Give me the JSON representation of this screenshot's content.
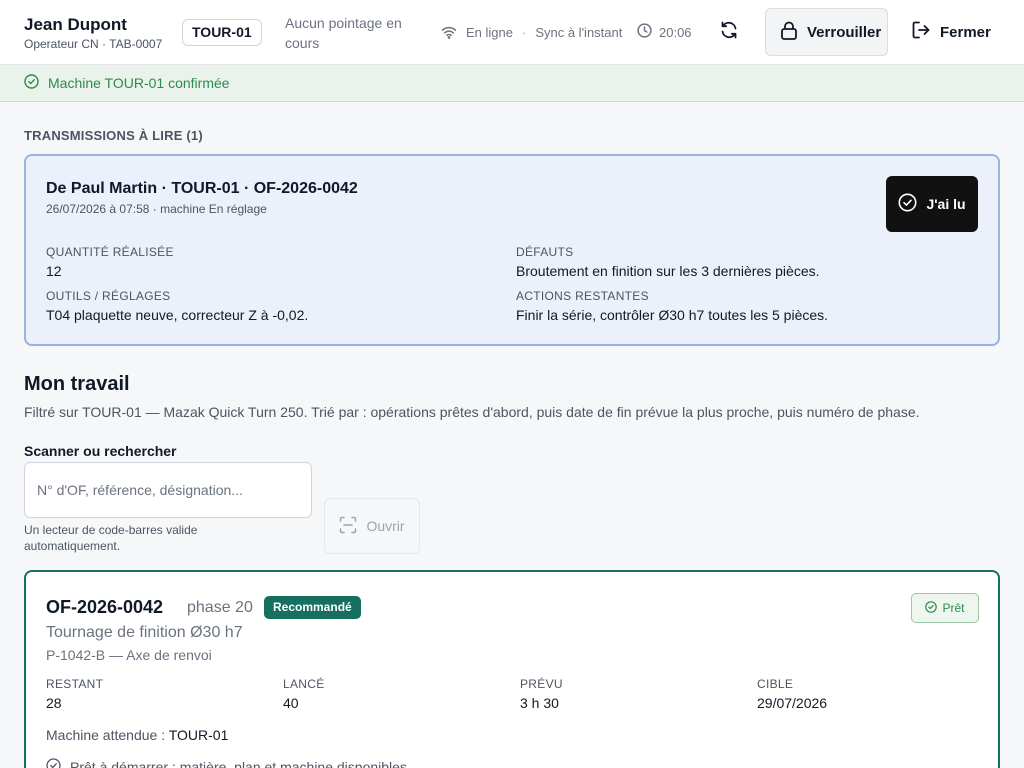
{
  "header": {
    "user_name": "Jean Dupont",
    "user_role": "Operateur CN · TAB-0007",
    "machine": "TOUR-01",
    "pointage_status": "Aucun pointage en cours",
    "online_status": "En ligne",
    "sync_status": "Sync à l'instant",
    "time": "20:06",
    "sync_icon": "refresh-icon",
    "lock_label": "Verrouiller",
    "close_label": "Fermer"
  },
  "confirmation": {
    "message": "Machine TOUR-01 confirmée",
    "color": "#2f8a4b"
  },
  "transmissions": {
    "section_title": "TRANSMISSIONS À LIRE (1)",
    "card": {
      "title": "De Paul Martin · TOUR-01 · OF-2026-0042",
      "subtitle": "26/07/2026 à 07:58 · machine En réglage",
      "ack_label": "J'ai lu",
      "fields": {
        "quantite_label": "Quantité réalisée",
        "quantite_value": "12",
        "defauts_label": "Défauts",
        "defauts_value": "Broutement en finition sur les 3 dernières pièces.",
        "outils_label": "Outils / réglages",
        "outils_value": "T04 plaquette neuve, correcteur Z à -0,02.",
        "actions_label": "Actions restantes",
        "actions_value": "Finir la série, contrôler Ø30 h7 toutes les 5 pièces."
      }
    }
  },
  "work": {
    "title": "Mon travail",
    "description": "Filtré sur TOUR-01 — Mazak Quick Turn 250. Trié par : opérations prêtes d'abord, puis date de fin prévue la plus proche, puis numéro de phase.",
    "scan_label": "Scanner ou rechercher",
    "scan_placeholder": "N° d'OF, référence, désignation...",
    "scan_value": "",
    "scan_hint": "Un lecteur de code-barres valide automatiquement.",
    "open_label": "Ouvrir"
  },
  "of_card": {
    "number": "OF-2026-0042",
    "phase": "phase 20",
    "badge": "Recommandé",
    "status": "Prêt",
    "designation": "Tournage de finition Ø30 h7",
    "reference": "P-1042-B — Axe de renvoi",
    "stats": {
      "restant_label": "Restant",
      "restant_value": "28",
      "lance_label": "Lancé",
      "lance_value": "40",
      "prevu_label": "Prévu",
      "prevu_value": "3 h 30",
      "cible_label": "Cible",
      "cible_value": "29/07/2026"
    },
    "expected_machine_label": "Machine attendue : ",
    "expected_machine_value": "TOUR-01",
    "ready_message": "Prêt à démarrer : matière, plan et machine disponibles.",
    "accent_color": "#17705f"
  }
}
